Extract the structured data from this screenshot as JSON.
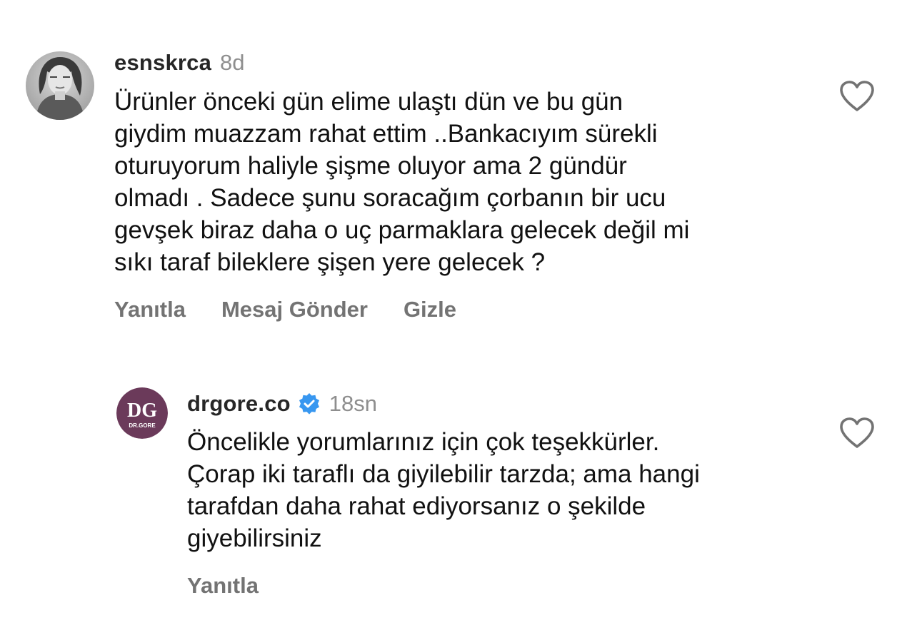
{
  "comments": [
    {
      "username": "esnskrca",
      "time": "8d",
      "lines": [
        "Ürünler önceki gün elime ulaştı dün ve bu gün",
        "giydim muazzam rahat ettim ..Bankacıyım sürekli",
        "oturuyorum haliyle şişme oluyor ama 2 gündür",
        "olmadı . Sadece şunu soracağım çorbanın bir ucu",
        "gevşek biraz daha o uç parmaklara gelecek değil mi",
        "sıkı taraf bileklere şişen yere gelecek ?"
      ],
      "actions": {
        "reply": "Yanıtla",
        "send_message": "Mesaj Gönder",
        "hide": "Gizle"
      },
      "icon_like": "heart-outline-icon"
    },
    {
      "username": "drgore.co",
      "verified": true,
      "time": "18sn",
      "avatar_text": "DG",
      "avatar_subtext": "DR.GORE",
      "avatar_color": "#6b3a5a",
      "lines": [
        "Öncelikle yorumlarınız için çok teşekkürler.",
        "Çorap iki taraflı da giyilebilir tarzda; ama hangi",
        "tarafdan daha rahat ediyorsanız o şekilde",
        "giyebilirsiniz"
      ],
      "actions": {
        "reply": "Yanıtla"
      },
      "icon_like": "heart-outline-icon"
    }
  ],
  "colors": {
    "verified_badge": "#3897f0",
    "secondary_text": "#737373",
    "time_text": "#8e8e8e"
  }
}
